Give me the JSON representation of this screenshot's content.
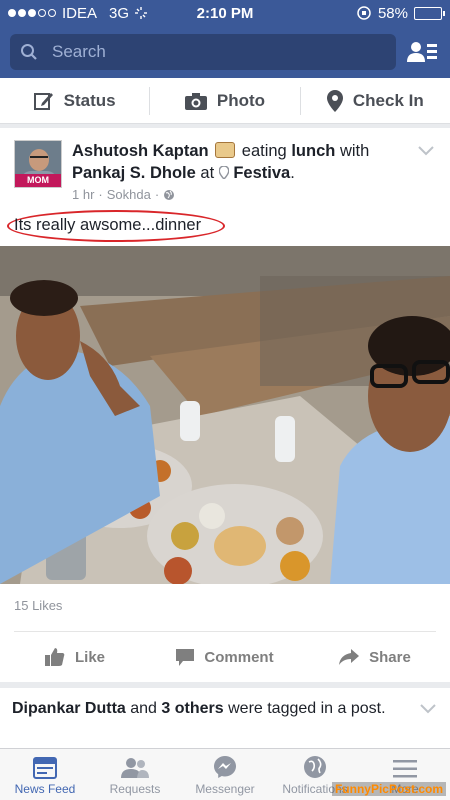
{
  "status_bar": {
    "carrier": "IDEA",
    "network": "3G",
    "time": "2:10 PM",
    "battery": "58%",
    "battery_level": 0.58,
    "signal_bars": 3,
    "signal_total": 5
  },
  "search": {
    "placeholder": "Search"
  },
  "composer": {
    "status": "Status",
    "photo": "Photo",
    "checkin": "Check In"
  },
  "post": {
    "author": "Ashutosh Kaptan",
    "verb": "eating",
    "activity": "lunch",
    "with_word": "with",
    "friend": "Pankaj S. Dhole",
    "at_word": "at",
    "place": "Festiva",
    "time": "1 hr",
    "location": "Sokhda",
    "avatar_badge": "MOM",
    "caption": "Its really awsome...dinner",
    "likes": "15 Likes",
    "actions": {
      "like": "Like",
      "comment": "Comment",
      "share": "Share"
    }
  },
  "next_post": {
    "name": "Dipankar Dutta",
    "and": "and",
    "others": "3 others",
    "rest": "were tagged in a post."
  },
  "tabs": {
    "news_feed": "News Feed",
    "requests": "Requests",
    "messenger": "Messenger",
    "notifications": "Notifications",
    "more": "More"
  },
  "watermark": "FunnyPicPost.com",
  "colors": {
    "brand": "#3b5998",
    "active_tab": "#4267b2",
    "annotation": "#d9262a"
  }
}
